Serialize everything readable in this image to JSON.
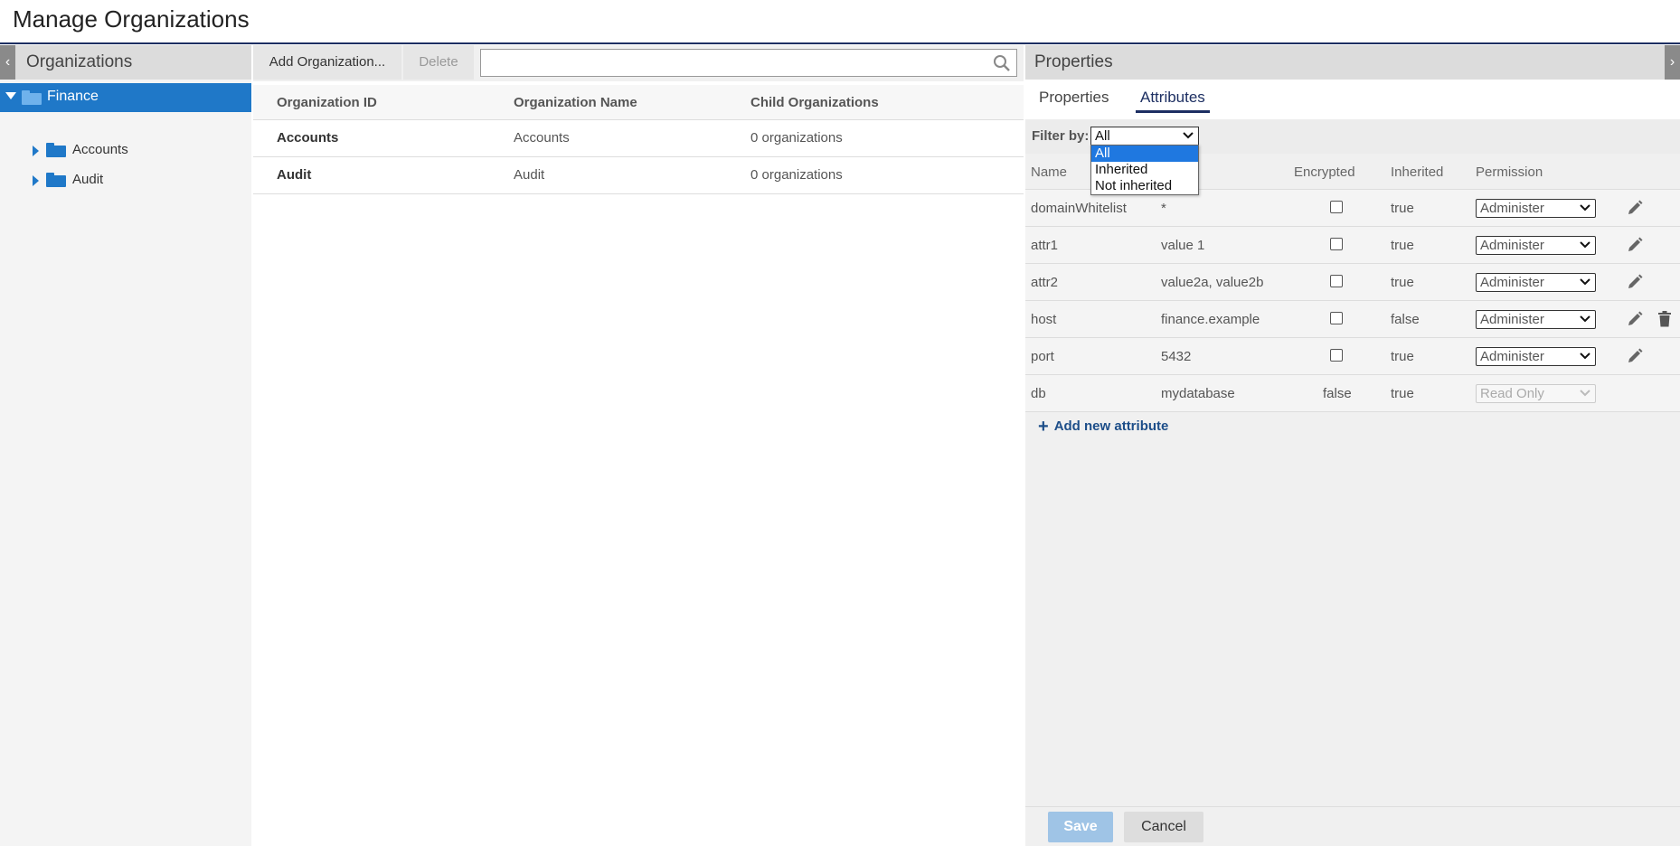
{
  "page": {
    "title": "Manage Organizations"
  },
  "left": {
    "header": "Organizations",
    "tree": {
      "root": "Finance",
      "children": [
        "Accounts",
        "Audit"
      ]
    }
  },
  "middle": {
    "toolbar": {
      "add_label": "Add Organization...",
      "delete_label": "Delete",
      "search_placeholder": ""
    },
    "columns": [
      "Organization ID",
      "Organization Name",
      "Child Organizations"
    ],
    "rows": [
      {
        "id": "Accounts",
        "name": "Accounts",
        "children": "0 organizations"
      },
      {
        "id": "Audit",
        "name": "Audit",
        "children": "0 organizations"
      }
    ]
  },
  "right": {
    "header": "Properties",
    "tabs": [
      "Properties",
      "Attributes"
    ],
    "active_tab": "Attributes",
    "filter": {
      "label": "Filter by:",
      "selected": "All",
      "options": [
        "All",
        "Inherited",
        "Not inherited"
      ]
    },
    "columns": [
      "Name",
      "Encrypted",
      "Inherited",
      "Permission"
    ],
    "rows": [
      {
        "name": "domainWhitelist",
        "value": "*",
        "encrypted": "",
        "inherited": "true",
        "permission": "Administer",
        "editable": true,
        "deletable": false
      },
      {
        "name": "attr1",
        "value": "value 1",
        "encrypted": "",
        "inherited": "true",
        "permission": "Administer",
        "editable": true,
        "deletable": false
      },
      {
        "name": "attr2",
        "value": "value2a, value2b",
        "encrypted": "",
        "inherited": "true",
        "permission": "Administer",
        "editable": true,
        "deletable": false
      },
      {
        "name": "host",
        "value": "finance.example",
        "encrypted": "",
        "inherited": "false",
        "permission": "Administer",
        "editable": true,
        "deletable": true
      },
      {
        "name": "port",
        "value": "5432",
        "encrypted": "",
        "inherited": "true",
        "permission": "Administer",
        "editable": true,
        "deletable": false
      },
      {
        "name": "db",
        "value": "mydatabase",
        "encrypted": "false",
        "inherited": "true",
        "permission": "Read Only",
        "editable": false,
        "deletable": false
      }
    ],
    "add_attribute": "Add new attribute",
    "footer": {
      "save_label": "Save",
      "cancel_label": "Cancel"
    }
  },
  "colors": {
    "accent": "#1f78c8",
    "navy": "#1d2f62",
    "save_disabled": "#9fc4e6"
  }
}
